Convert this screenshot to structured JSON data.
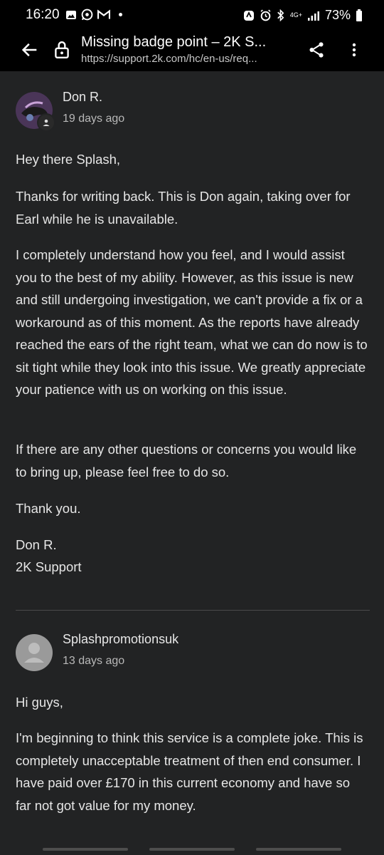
{
  "status_bar": {
    "time": "16:20",
    "network": "4G+",
    "battery": "73%"
  },
  "app_bar": {
    "title": "Missing badge point – 2K S...",
    "url": "https://support.2k.com/hc/en-us/req..."
  },
  "posts": [
    {
      "author": "Don R.",
      "date": "19 days ago",
      "paragraphs": [
        "Hey there Splash,",
        "Thanks for writing back. This is Don again, taking over for Earl while he is unavailable.",
        "I completely understand how you feel, and I would assist you to the best of my ability. However, as this issue is new and still undergoing investigation, we can't provide a fix or a workaround as of this moment. As the reports have already reached the ears of the right team, what we can do now is to sit tight while they look into this issue. We greatly appreciate your patience with us on working on this issue.",
        "If there are any other questions or concerns you would like to bring up, please feel free to do so.",
        "Thank you.",
        "Don R.",
        "2K Support"
      ]
    },
    {
      "author": "Splashpromotionsuk",
      "date": "13 days ago",
      "paragraphs": [
        "Hi guys,",
        "I'm beginning to think this service is a complete joke. This is completely unacceptable treatment of then end consumer. I have paid over £170 in this current economy and have so far not got value for my money."
      ]
    }
  ]
}
